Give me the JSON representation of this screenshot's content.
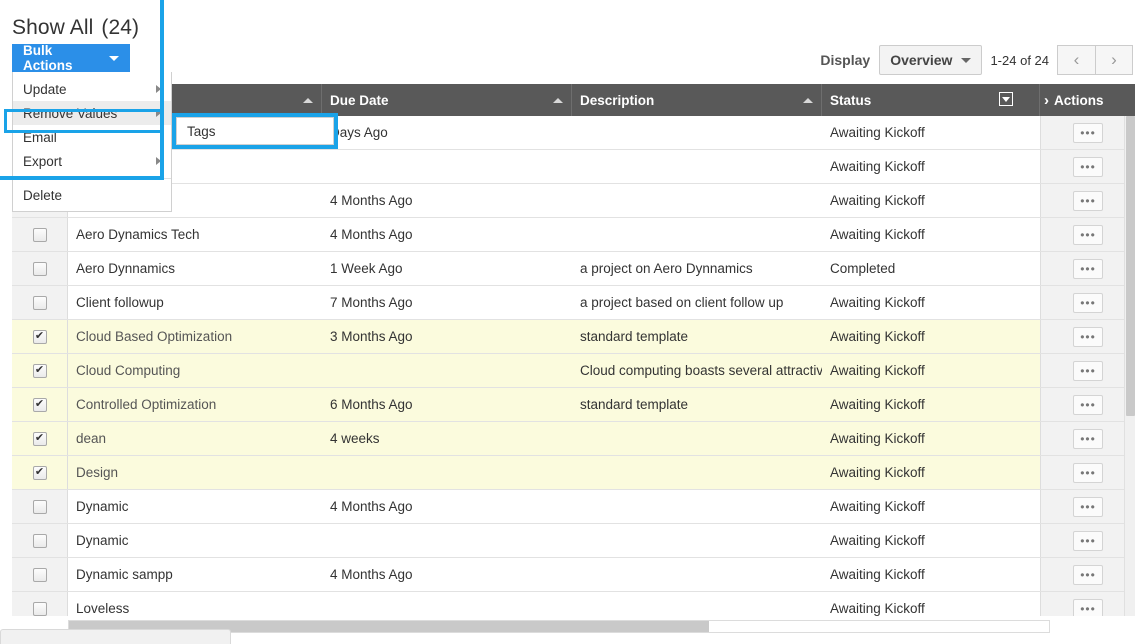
{
  "header": {
    "title": "Show All",
    "count": "(24)"
  },
  "display": {
    "label": "Display",
    "selected_view": "Overview",
    "view_options": [
      "Overview"
    ],
    "pagination_text": "1-24 of 24",
    "prev_icon": "chevron-left-icon",
    "next_icon": "chevron-right-icon"
  },
  "bulk_actions": {
    "button_label": "Bulk Actions",
    "caret_icon": "caret-down-icon",
    "items": [
      {
        "label": "Update",
        "has_submenu": true
      },
      {
        "label": "Remove Values",
        "has_submenu": true,
        "active": true
      },
      {
        "label": "Email",
        "has_submenu": false
      },
      {
        "label": "Export",
        "has_submenu": true
      },
      {
        "label": "Delete",
        "has_submenu": false
      }
    ],
    "submenu": {
      "parent": "Remove Values",
      "items": [
        "Tags"
      ]
    },
    "highlight_color": "#1aa3e8",
    "button_color": "#2b8fe8"
  },
  "table": {
    "columns": [
      {
        "key": "checkbox",
        "label": ""
      },
      {
        "key": "name",
        "label": "",
        "sortable": true
      },
      {
        "key": "due_date",
        "label": "Due Date",
        "sortable": true
      },
      {
        "key": "description",
        "label": "Description",
        "sortable": true
      },
      {
        "key": "status",
        "label": "Status",
        "sortable": false,
        "filter_icon": "funnel-icon"
      },
      {
        "key": "actions",
        "label": "Actions",
        "chevron_icon": "chevron-right-icon"
      }
    ],
    "rows": [
      {
        "checked": false,
        "name": "",
        "due_date": "Days Ago",
        "description": "",
        "status": "Awaiting Kickoff"
      },
      {
        "checked": false,
        "name": "",
        "due_date": "",
        "description": "",
        "status": "Awaiting Kickoff"
      },
      {
        "checked": false,
        "name": "",
        "due_date": "4 Months Ago",
        "description": "",
        "status": "Awaiting Kickoff"
      },
      {
        "checked": false,
        "name": "Aero Dynamics Tech",
        "due_date": "4 Months Ago",
        "description": "",
        "status": "Awaiting Kickoff"
      },
      {
        "checked": false,
        "name": "Aero Dynnamics",
        "due_date": "1 Week Ago",
        "description": "a project on Aero Dynnamics",
        "status": "Completed"
      },
      {
        "checked": false,
        "name": "Client followup",
        "due_date": "7 Months Ago",
        "description": "a project based on client follow up",
        "status": "Awaiting Kickoff"
      },
      {
        "checked": true,
        "name": "Cloud Based Optimization",
        "due_date": "3 Months Ago",
        "description": "standard template",
        "status": "Awaiting Kickoff"
      },
      {
        "checked": true,
        "name": "Cloud Computing",
        "due_date": "",
        "description": "Cloud computing boasts several attractive b…",
        "status": "Awaiting Kickoff"
      },
      {
        "checked": true,
        "name": "Controlled Optimization",
        "due_date": "6 Months Ago",
        "description": "standard template",
        "status": "Awaiting Kickoff"
      },
      {
        "checked": true,
        "name": "dean",
        "due_date": "4 weeks",
        "description": "",
        "status": "Awaiting Kickoff"
      },
      {
        "checked": true,
        "name": "Design",
        "due_date": "",
        "description": "",
        "status": "Awaiting Kickoff"
      },
      {
        "checked": false,
        "name": "Dynamic",
        "due_date": "4 Months Ago",
        "description": "",
        "status": "Awaiting Kickoff"
      },
      {
        "checked": false,
        "name": "Dynamic",
        "due_date": "",
        "description": "",
        "status": "Awaiting Kickoff"
      },
      {
        "checked": false,
        "name": "Dynamic sampp",
        "due_date": "4 Months Ago",
        "description": "",
        "status": "Awaiting Kickoff"
      },
      {
        "checked": false,
        "name": "Loveless",
        "due_date": "",
        "description": "",
        "status": "Awaiting Kickoff"
      }
    ],
    "row_action_label": "•••",
    "selected_row_color": "#fbfbdd"
  }
}
